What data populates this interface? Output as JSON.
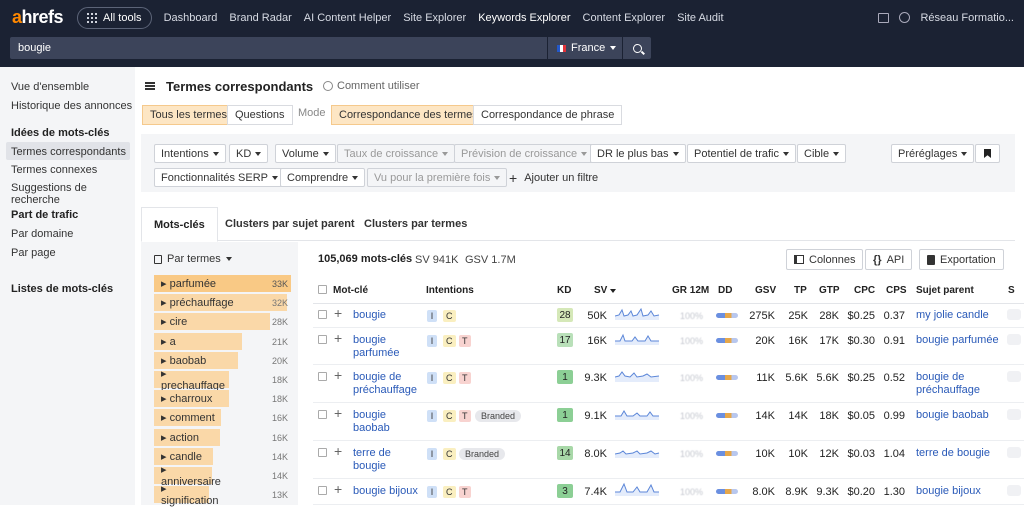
{
  "nav": {
    "logo_a": "a",
    "logo_rest": "hrefs",
    "all_tools": "All tools",
    "links": [
      "Dashboard",
      "Brand Radar",
      "AI Content Helper",
      "Site Explorer",
      "Keywords Explorer",
      "Content Explorer",
      "Site Audit"
    ],
    "active": "Keywords Explorer",
    "account": "Réseau Formatio..."
  },
  "search": {
    "query": "bougie",
    "country": "France"
  },
  "sidebar": {
    "overview": "Vue d'ensemble",
    "ads_history": "Historique des annonces",
    "ideas_heading": "Idées de mots-clés",
    "ideas": [
      "Termes correspondants",
      "Termes connexes",
      "Suggestions de recherche"
    ],
    "traffic_heading": "Part de trafic",
    "traffic": [
      "Par domaine",
      "Par page"
    ],
    "lists_heading": "Listes de mots-clés"
  },
  "header": {
    "title": "Termes correspondants",
    "how_to": "Comment utiliser"
  },
  "modes": {
    "all_terms": "Tous les termes",
    "questions": "Questions",
    "mode_label": "Mode",
    "match_terms": "Correspondance des termes",
    "match_phrase": "Correspondance de phrase"
  },
  "filters": {
    "row1": [
      "Intentions",
      "KD",
      "Volume",
      "Taux de croissance",
      "Prévision de croissance",
      "DR le plus bas",
      "Potentiel de trafic",
      "Cible"
    ],
    "row2": [
      "Fonctionnalités SERP",
      "Comprendre",
      "Vu pour la première fois"
    ],
    "add_filter": "Ajouter un filtre",
    "presets": "Préréglages"
  },
  "tabs": [
    "Mots-clés",
    "Clusters par sujet parent",
    "Clusters par termes"
  ],
  "cluster_panel": {
    "by_terms": "Par termes",
    "items": [
      {
        "label": "parfumée",
        "count": "33K",
        "share": 1.0
      },
      {
        "label": "préchauffage",
        "count": "32K",
        "share": 0.97
      },
      {
        "label": "cire",
        "count": "28K",
        "share": 0.85
      },
      {
        "label": "a",
        "count": "21K",
        "share": 0.64
      },
      {
        "label": "baobab",
        "count": "20K",
        "share": 0.61
      },
      {
        "label": "prechauffage",
        "count": "18K",
        "share": 0.55
      },
      {
        "label": "charroux",
        "count": "18K",
        "share": 0.55
      },
      {
        "label": "comment",
        "count": "16K",
        "share": 0.49
      },
      {
        "label": "action",
        "count": "16K",
        "share": 0.48
      },
      {
        "label": "candle",
        "count": "14K",
        "share": 0.43
      },
      {
        "label": "anniversaire",
        "count": "14K",
        "share": 0.42
      },
      {
        "label": "signification",
        "count": "13K",
        "share": 0.4
      }
    ]
  },
  "results": {
    "total": "105,069 mots-clés",
    "sv": "SV 941K",
    "gsv": "GSV 1.7M",
    "columns_btn": "Colonnes",
    "api_btn": "API",
    "export_btn": "Exportation"
  },
  "table": {
    "headers": {
      "keyword": "Mot-clé",
      "intents": "Intentions",
      "kd": "KD",
      "sv": "SV",
      "gr": "GR 12M",
      "dd": "DD",
      "gsv": "GSV",
      "tp": "TP",
      "gtp": "GTP",
      "cpc": "CPC",
      "cps": "CPS",
      "parent": "Sujet parent",
      "s": "S"
    },
    "blurred": "100%",
    "rows": [
      {
        "kw": [
          "bougie"
        ],
        "tags": [
          "I",
          "C"
        ],
        "kd": "28",
        "kd_color": "#d5e8b8",
        "sv": "50K",
        "gsv": "275K",
        "tp": "25K",
        "gtp": "28K",
        "cpc": "$0.25",
        "cps": "0.37",
        "parent": [
          "my jolie candle"
        ]
      },
      {
        "kw": [
          "bougie",
          "parfumée"
        ],
        "tags": [
          "I",
          "C",
          "T"
        ],
        "kd": "17",
        "kd_color": "#b9e0b9",
        "sv": "16K",
        "gsv": "20K",
        "tp": "16K",
        "gtp": "17K",
        "cpc": "$0.30",
        "cps": "0.91",
        "parent": [
          "bougie parfumée"
        ]
      },
      {
        "kw": [
          "bougie de",
          "préchauffage"
        ],
        "tags": [
          "I",
          "C",
          "T"
        ],
        "kd": "1",
        "kd_color": "#8ccf95",
        "sv": "9.3K",
        "gsv": "11K",
        "tp": "5.6K",
        "gtp": "5.6K",
        "cpc": "$0.25",
        "cps": "0.52",
        "parent": [
          "bougie de",
          "préchauffage"
        ]
      },
      {
        "kw": [
          "bougie",
          "baobab"
        ],
        "tags": [
          "I",
          "C",
          "T",
          "Branded"
        ],
        "kd": "1",
        "kd_color": "#8ccf95",
        "sv": "9.1K",
        "gsv": "14K",
        "tp": "14K",
        "gtp": "18K",
        "cpc": "$0.05",
        "cps": "0.99",
        "parent": [
          "bougie baobab"
        ]
      },
      {
        "kw": [
          "terre de",
          "bougie"
        ],
        "tags": [
          "I",
          "C",
          "Branded"
        ],
        "kd": "14",
        "kd_color": "#a8d8a8",
        "sv": "8.0K",
        "gsv": "10K",
        "tp": "10K",
        "gtp": "12K",
        "cpc": "$0.03",
        "cps": "1.04",
        "parent": [
          "terre de bougie"
        ]
      },
      {
        "kw": [
          "bougie bijoux"
        ],
        "tags": [
          "I",
          "C",
          "T"
        ],
        "kd": "3",
        "kd_color": "#8ccf95",
        "sv": "7.4K",
        "gsv": "8.0K",
        "tp": "8.9K",
        "gtp": "9.3K",
        "cpc": "$0.20",
        "cps": "1.30",
        "parent": [
          "bougie bijoux"
        ]
      }
    ]
  },
  "colors": {
    "nav_bg": "#1b2233",
    "brand_orange": "#ff8800",
    "active_seg": "#fde6c4",
    "link_blue": "#2a5ab8"
  }
}
